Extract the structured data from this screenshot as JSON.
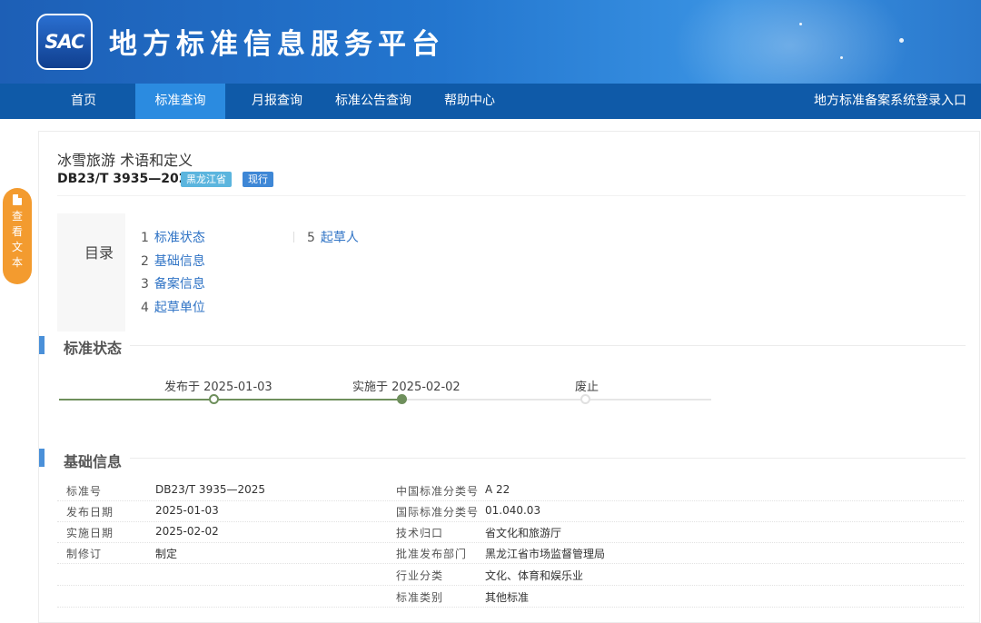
{
  "header": {
    "logo_text": "SAC",
    "site_title": "地方标准信息服务平台"
  },
  "nav": {
    "items": [
      "首页",
      "标准查询",
      "月报查询",
      "标准公告查询",
      "帮助中心"
    ],
    "active_index": 1,
    "login_link": "地方标准备案系统登录入口"
  },
  "float_tab": {
    "label": [
      "查",
      "看",
      "文",
      "本"
    ]
  },
  "doc": {
    "title": "冰雪旅游 术语和定义",
    "code": "DB23/T 3935—2025",
    "region_badge": "黑龙江省",
    "status_badge": "现行"
  },
  "toc": {
    "label": "目录",
    "items": [
      {
        "num": "1",
        "text": "标准状态"
      },
      {
        "num": "2",
        "text": "基础信息"
      },
      {
        "num": "3",
        "text": "备案信息"
      },
      {
        "num": "4",
        "text": "起草单位"
      },
      {
        "num": "5",
        "text": "起草人"
      }
    ]
  },
  "status_section": {
    "title": "标准状态",
    "timeline": [
      {
        "label": "发布于 2025-01-03"
      },
      {
        "label": "实施于 2025-02-02"
      },
      {
        "label": "废止"
      }
    ]
  },
  "basic_section": {
    "title": "基础信息",
    "rows": [
      {
        "k1": "标准号",
        "v1": "DB23/T 3935—2025",
        "k2": "中国标准分类号",
        "v2": "A 22"
      },
      {
        "k1": "发布日期",
        "v1": "2025-01-03",
        "k2": "国际标准分类号",
        "v2": "01.040.03"
      },
      {
        "k1": "实施日期",
        "v1": "2025-02-02",
        "k2": "技术归口",
        "v2": "省文化和旅游厅"
      },
      {
        "k1": "制修订",
        "v1": "制定",
        "k2": "批准发布部门",
        "v2": "黑龙江省市场监督管理局"
      },
      {
        "k1": "",
        "v1": "",
        "k2": "行业分类",
        "v2": "文化、体育和娱乐业"
      },
      {
        "k1": "",
        "v1": "",
        "k2": "标准类别",
        "v2": "其他标准"
      }
    ]
  },
  "colors": {
    "header_blue": "#2376cf",
    "nav_blue": "#0f5aa8",
    "nav_active": "#2b8be0",
    "timeline_done": "#6e8f5c",
    "float_orange": "#f39b2f"
  }
}
